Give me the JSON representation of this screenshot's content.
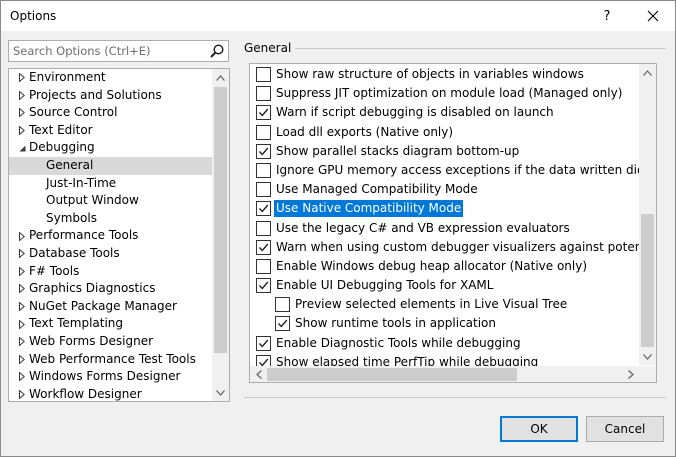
{
  "window": {
    "title": "Options",
    "help_label": "?",
    "close_label": "✕"
  },
  "search": {
    "placeholder": "Search Options (Ctrl+E)",
    "value": "",
    "icon": "search-icon"
  },
  "tree": {
    "items": [
      {
        "label": "Environment",
        "level": 0,
        "expander": "collapsed",
        "selected": false
      },
      {
        "label": "Projects and Solutions",
        "level": 0,
        "expander": "collapsed",
        "selected": false
      },
      {
        "label": "Source Control",
        "level": 0,
        "expander": "collapsed",
        "selected": false
      },
      {
        "label": "Text Editor",
        "level": 0,
        "expander": "collapsed",
        "selected": false
      },
      {
        "label": "Debugging",
        "level": 0,
        "expander": "expanded",
        "selected": false
      },
      {
        "label": "General",
        "level": 1,
        "expander": "none",
        "selected": true
      },
      {
        "label": "Just-In-Time",
        "level": 1,
        "expander": "none",
        "selected": false
      },
      {
        "label": "Output Window",
        "level": 1,
        "expander": "none",
        "selected": false
      },
      {
        "label": "Symbols",
        "level": 1,
        "expander": "none",
        "selected": false
      },
      {
        "label": "Performance Tools",
        "level": 0,
        "expander": "collapsed",
        "selected": false
      },
      {
        "label": "Database Tools",
        "level": 0,
        "expander": "collapsed",
        "selected": false
      },
      {
        "label": "F# Tools",
        "level": 0,
        "expander": "collapsed",
        "selected": false
      },
      {
        "label": "Graphics Diagnostics",
        "level": 0,
        "expander": "collapsed",
        "selected": false
      },
      {
        "label": "NuGet Package Manager",
        "level": 0,
        "expander": "collapsed",
        "selected": false
      },
      {
        "label": "Text Templating",
        "level": 0,
        "expander": "collapsed",
        "selected": false
      },
      {
        "label": "Web Forms Designer",
        "level": 0,
        "expander": "collapsed",
        "selected": false
      },
      {
        "label": "Web Performance Test Tools",
        "level": 0,
        "expander": "collapsed",
        "selected": false
      },
      {
        "label": "Windows Forms Designer",
        "level": 0,
        "expander": "collapsed",
        "selected": false
      },
      {
        "label": "Workflow Designer",
        "level": 0,
        "expander": "collapsed",
        "selected": false
      }
    ]
  },
  "section": {
    "title": "General"
  },
  "options": [
    {
      "label": "Show raw structure of objects in variables windows",
      "checked": false,
      "indent": 0,
      "highlighted": false
    },
    {
      "label": "Suppress JIT optimization on module load (Managed only)",
      "checked": false,
      "indent": 0,
      "highlighted": false
    },
    {
      "label": "Warn if script debugging is disabled on launch",
      "checked": true,
      "indent": 0,
      "highlighted": false
    },
    {
      "label": "Load dll exports (Native only)",
      "checked": false,
      "indent": 0,
      "highlighted": false
    },
    {
      "label": "Show parallel stacks diagram bottom-up",
      "checked": true,
      "indent": 0,
      "highlighted": false
    },
    {
      "label": "Ignore GPU memory access exceptions if the data written didn't chan",
      "checked": false,
      "indent": 0,
      "highlighted": false
    },
    {
      "label": "Use Managed Compatibility Mode",
      "checked": false,
      "indent": 0,
      "highlighted": false
    },
    {
      "label": "Use Native Compatibility Mode",
      "checked": true,
      "indent": 0,
      "highlighted": true
    },
    {
      "label": "Use the legacy C# and VB expression evaluators",
      "checked": false,
      "indent": 0,
      "highlighted": false
    },
    {
      "label": "Warn when using custom debugger visualizers against potentially uns",
      "checked": true,
      "indent": 0,
      "highlighted": false
    },
    {
      "label": "Enable Windows debug heap allocator (Native only)",
      "checked": false,
      "indent": 0,
      "highlighted": false
    },
    {
      "label": "Enable UI Debugging Tools for XAML",
      "checked": true,
      "indent": 0,
      "highlighted": false
    },
    {
      "label": "Preview selected elements in Live Visual Tree",
      "checked": false,
      "indent": 1,
      "highlighted": false
    },
    {
      "label": "Show runtime tools in application",
      "checked": true,
      "indent": 1,
      "highlighted": false
    },
    {
      "label": "Enable Diagnostic Tools while debugging",
      "checked": true,
      "indent": 0,
      "highlighted": false
    },
    {
      "label": "Show elapsed time PerfTip while debugging",
      "checked": true,
      "indent": 0,
      "highlighted": false
    }
  ],
  "buttons": {
    "ok_label": "OK",
    "cancel_label": "Cancel"
  },
  "colors": {
    "selection": "#0078d7",
    "tree_selection": "#cce8ff",
    "window_bg": "#f0f0f0"
  }
}
